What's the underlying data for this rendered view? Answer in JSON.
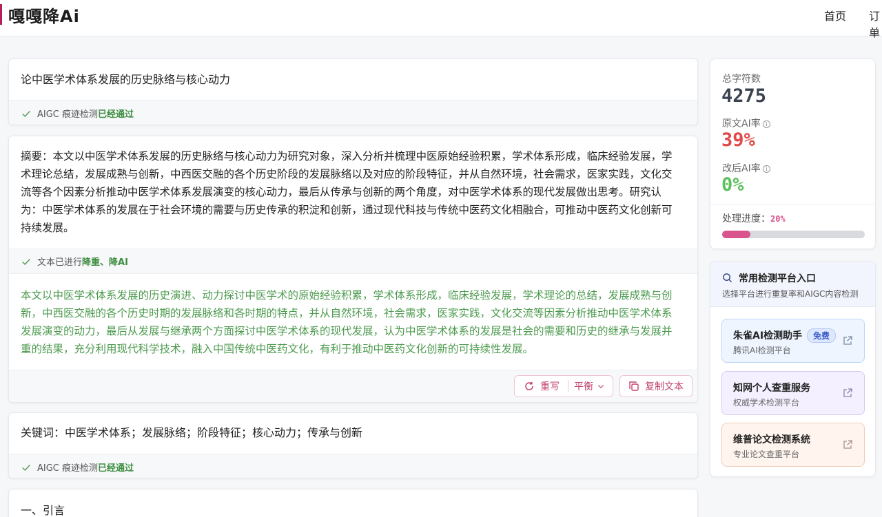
{
  "header": {
    "logo": "嘎嘎降Ai",
    "nav": [
      "首页",
      "订单"
    ]
  },
  "cards": {
    "title": {
      "text": "论中医学术体系发展的历史脉络与核心动力",
      "status_prefix": "AIGC 痕迹检测",
      "status_ok": "已经通过"
    },
    "abstract": {
      "original": "摘要：本文以中医学术体系发展的历史脉络与核心动力为研究对象，深入分析并梳理中医原始经验积累，学术体系形成，临床经验发展，学术理论总结，发展成熟与创新，中西医交融的各个历史阶段的发展脉络以及对应的阶段特征，并从自然环境，社会需求，医家实践，文化交流等各个因素分析推动中医学术体系发展演变的核心动力，最后从传承与创新的两个角度，对中医学术体系的现代发展做出思考。研究认为：中医学术体系的发展在于社会环境的需要与历史传承的积淀和创新，通过现代科技与传统中医药文化相融合，可推动中医药文化创新可持续发展。",
      "status_prefix": "文本已进行",
      "status_ok": "降重、降AI",
      "rewritten": "本文以中医学术体系发展的历史演进、动力探讨中医学术的原始经验积累，学术体系形成，临床经验发展，学术理论的总结，发展成熟与创新，中西医交融的各个历史时期的发展脉络和各时期的特点，并从自然环境，社会需求，医家实践，文化交流等因素分析推动中医学术体系发展演变的动力，最后从发展与继承两个方面探讨中医学术体系的现代发展，认为中医学术体系的发展是社会的需要和历史的继承与发展并重的结果，充分利用现代科学技术，融入中国传统中医药文化，有利于推动中医药文化创新的可持续性发展。",
      "rewrite_label": "重写",
      "mode_label": "平衡",
      "copy_label": "复制文本"
    },
    "keywords": {
      "text": "关键词：中医学术体系；发展脉络；阶段特征；核心动力；传承与创新",
      "status_prefix": "AIGC 痕迹检测",
      "status_ok": "已经通过"
    },
    "intro": {
      "text": "一、引言"
    }
  },
  "stats": {
    "total_label": "总字符数",
    "total_value": "4275",
    "orig_label": "原文AI率",
    "orig_value": "39%",
    "after_label": "改后AI率",
    "after_value": "0%",
    "progress_label": "处理进度：",
    "progress_value": "20%",
    "progress_fraction": 0.2,
    "colors": {
      "orig": "#e04a4a",
      "after": "#5dc05d",
      "progress": "#d9538c"
    }
  },
  "platforms": {
    "title": "常用检测平台入口",
    "subtitle": "选择平台进行重复率和AIGC内容检测",
    "items": [
      {
        "name": "朱雀AI检测助手",
        "badge": "免费",
        "sub": "腾讯AI检测平台"
      },
      {
        "name": "知网个人查重服务",
        "sub": "权威学术检测平台"
      },
      {
        "name": "维普论文检测系统",
        "sub": "专业论文查重平台"
      }
    ]
  }
}
